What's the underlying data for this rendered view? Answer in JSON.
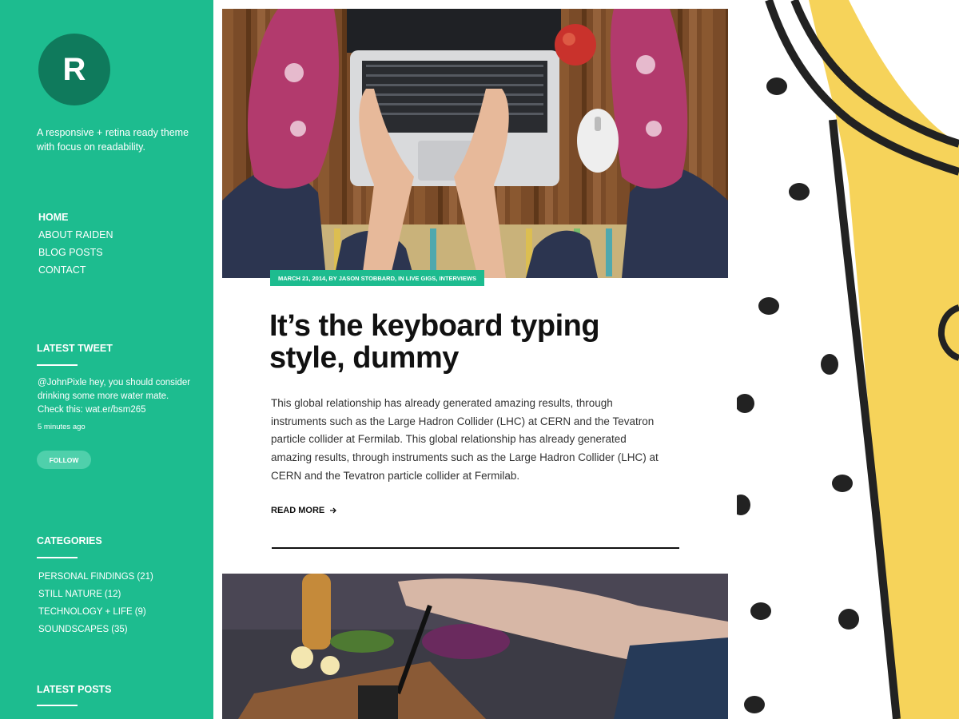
{
  "site": {
    "logo_letter": "R",
    "tagline": "A responsive + retina ready theme with focus on readability."
  },
  "nav": {
    "items": [
      {
        "label": "HOME",
        "active": true
      },
      {
        "label": "ABOUT RAIDEN",
        "active": false
      },
      {
        "label": "BLOG POSTS",
        "active": false
      },
      {
        "label": "CONTACT",
        "active": false
      }
    ]
  },
  "widgets": {
    "tweet": {
      "title": "LATEST TWEET",
      "text": "@JohnPixle hey, you should consider drinking some more water mate. Check this: wat.er/bsm265",
      "time": "5 minutes ago",
      "follow_label": "FOLLOW"
    },
    "categories": {
      "title": "CATEGORIES",
      "items": [
        {
          "name": "PERSONAL FINDINGS",
          "count": "(21)"
        },
        {
          "name": "STILL NATURE",
          "count": "(12)"
        },
        {
          "name": "TECHNOLOGY + LIFE",
          "count": "(9)"
        },
        {
          "name": "SOUNDSCAPES",
          "count": "(35)"
        }
      ]
    },
    "latest_posts": {
      "title": "LATEST POSTS"
    }
  },
  "post": {
    "meta": "MARCH 21, 2014, BY JASON STOBBARD, IN LIVE GIGS, INTERVIEWS",
    "title": "It’s the keyboard typing style, dummy",
    "excerpt": "This global relationship has already generated amazing results, through instruments such as the Large Hadron Collider (LHC) at CERN and the Tevatron particle collider at Fermilab. This global relationship has already generated amazing results, through instruments such as the Large Hadron Collider (LHC) at CERN and the Tevatron particle collider at Fermilab.",
    "read_more": "READ MORE"
  },
  "colors": {
    "accent": "#1dbc8f",
    "logo_bg": "#0f7a5c",
    "deco_yellow": "#f6d35a"
  }
}
